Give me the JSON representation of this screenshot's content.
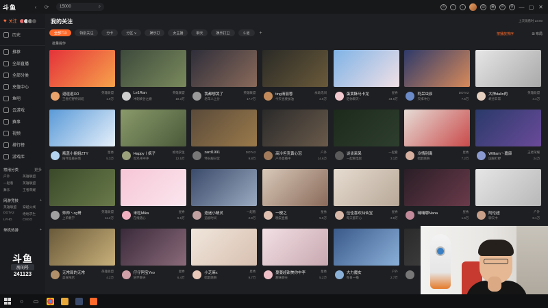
{
  "app": {
    "logo_text": "斗鱼",
    "search_value": "15000",
    "nav": {
      "back": "‹",
      "refresh": "⟳"
    },
    "window_controls": [
      "—",
      "▢",
      "✕"
    ]
  },
  "sidebar": {
    "follow_label": "关注",
    "history_label": "历史",
    "items": [
      {
        "label": "推荐"
      },
      {
        "label": "全部直播"
      },
      {
        "label": "全部分类"
      },
      {
        "label": "充值中心"
      },
      {
        "label": "鱼吧"
      },
      {
        "label": "云游戏"
      },
      {
        "label": "赛事"
      },
      {
        "label": "视频"
      },
      {
        "label": "排行榜"
      },
      {
        "label": "游戏库"
      }
    ],
    "section_common": "常用分类",
    "section_common_more": "更多",
    "common_cats": [
      "户外",
      "英雄联盟",
      "一起看",
      "英雄联盟",
      "舞乐",
      "王者荣耀"
    ],
    "section_hot": "网游竞技",
    "hot_cats": [
      "英雄联盟",
      "穿越火线",
      "DOTA2",
      "绝地求生",
      "LYHD",
      "CSGO"
    ],
    "section_mobile": "单机热游",
    "badge_logo": "斗鱼",
    "badge_sub": "房间号",
    "badge_num": "241123"
  },
  "main": {
    "title": "我的关注",
    "top_right": "上次观看时 23:00",
    "sort_label": "按播放排序",
    "layout_label": "⊞ 布局",
    "batch_label": "批量操作",
    "filters": [
      {
        "label": "全部713",
        "active": true
      },
      {
        "label": "特别关注",
        "active": false
      },
      {
        "label": "分卡",
        "active": false
      },
      {
        "label": "分区 ∨",
        "active": false
      },
      {
        "label": "娱乐打",
        "active": false
      },
      {
        "label": "女主播",
        "active": false
      },
      {
        "label": "聊天",
        "active": false
      },
      {
        "label": "娱乐打卫",
        "active": false
      },
      {
        "label": "斗道",
        "active": false
      }
    ],
    "cards": [
      {
        "name": "逗逗逗XO",
        "cat": "英雄联盟",
        "desc": "王者打野特训班",
        "heat": "1.9万",
        "bg": "linear-gradient(135deg,#e4323a,#f7a34b)",
        "av": "#e9a36b"
      },
      {
        "name": "Le1Ran",
        "cat": "英雄联盟",
        "desc": "冲刺峡谷之巅",
        "heat": "18.3万",
        "bg": "linear-gradient(135deg,#3d4a3c,#7a8a5c)",
        "av": "#cfcfcf"
      },
      {
        "name": "我都想哭了",
        "cat": "英雄联盟",
        "desc": "老年人上分",
        "heat": "17.7万",
        "bg": "linear-gradient(135deg,#2e2e3a,#8a6a5a)",
        "av": "#9a9a9a"
      },
      {
        "name": "ting清丽蓉",
        "cat": "永劫无间",
        "desc": "今天也要加油",
        "heat": "2.5万",
        "bg": "linear-gradient(135deg,#2a2a26,#6a5a3a)",
        "av": "#c28a5a"
      },
      {
        "name": "蛋黄酥马卡龙",
        "cat": "星秀",
        "desc": "陪你聊天~",
        "heat": "34.6万",
        "bg": "linear-gradient(135deg,#7fb3e6,#f1e0e6)",
        "av": "#f3c9d0"
      },
      {
        "name": "阿呆虫辰",
        "cat": "DOTA2",
        "desc": "天梯冲分",
        "heat": "7.5万",
        "bg": "linear-gradient(135deg,#2e3a6a,#d88a5a)",
        "av": "#6a8ac8"
      },
      {
        "name": "大神dalin的",
        "cat": "英雄联盟",
        "desc": "峡谷日常",
        "heat": "4.4万",
        "bg": "linear-gradient(135deg,#e6e6e6,#a9a9a9)",
        "av": "#e6d0c0"
      },
      {
        "name": "瓶盖小姐姐ZTY",
        "cat": "星秀",
        "desc": "陪伴是最长情",
        "heat": "5.3万",
        "bg": "linear-gradient(135deg,#5a9ad8,#e6f0fa)",
        "av": "#b2d2f0"
      },
      {
        "name": "Happy丨疯子",
        "cat": "绝地求生",
        "desc": "吃鸡冲冲冲",
        "heat": "12.5万",
        "bg": "linear-gradient(135deg,#8a9a6a,#4a5a3a)",
        "av": "#9aa07a"
      },
      {
        "name": "zard1991",
        "cat": "DOTA2",
        "desc": "怀旧服日常",
        "heat": "9.8万",
        "bg": "linear-gradient(135deg,#5a4a3a,#9a7a4a)",
        "av": "#777"
      },
      {
        "name": "高冷坦克黄心冠",
        "cat": "户外",
        "desc": "户外直播中",
        "heat": "14.6万",
        "bg": "linear-gradient(135deg,#2a2a2a,#6a5a4a)",
        "av": "#a07a5a"
      },
      {
        "name": "谈谈呆呆",
        "cat": "一起看",
        "desc": "一起看电影",
        "heat": "3.1万",
        "bg": "linear-gradient(135deg,#1c2a1c,#2e3e2e)",
        "av": "#5a5a5a"
      },
      {
        "name": "冷情别离",
        "cat": "星秀",
        "desc": "唱歌跳舞",
        "heat": "7.2万",
        "bg": "linear-gradient(135deg,#e6dcd6,#c94a4a)",
        "av": "#d7b0a0"
      },
      {
        "name": "William丶嘉康",
        "cat": "王者荣耀",
        "desc": "国服打野",
        "heat": "24万",
        "bg": "linear-gradient(135deg,#2a3a6a,#6a4a9a)",
        "av": "#8a9ad0"
      },
      {
        "name": "帅帅丶cg哥",
        "cat": "英雄联盟",
        "desc": "上单教学",
        "heat": "11.2万",
        "bg": "linear-gradient(135deg,#3a4a2a,#6a7a4a)",
        "av": "#a0a0a0"
      },
      {
        "name": "米粒Mika",
        "cat": "星秀",
        "desc": "在线随心",
        "heat": "6.6万",
        "bg": "linear-gradient(135deg,#f7c6d6,#fae6ee)",
        "av": "#f0b0c0"
      },
      {
        "name": "逐迷小精灵",
        "cat": "一起看",
        "desc": "追剧时间",
        "heat": "2.9万",
        "bg": "linear-gradient(135deg,#3a4a6a,#9aaac0)",
        "av": "#c0a0a0"
      },
      {
        "name": "一梗之",
        "cat": "星秀",
        "desc": "晚安直播",
        "heat": "5.5万",
        "bg": "linear-gradient(135deg,#d8c8b8,#8a6a5a)",
        "av": "#e0c0b0"
      },
      {
        "name": "佳佳喜欢仙仙宝",
        "cat": "星秀",
        "desc": "每天都开心",
        "heat": "3.8万",
        "bg": "linear-gradient(135deg,#e6dcd0,#b8a898)",
        "av": "#d8b8a8"
      },
      {
        "name": "哺哺哪Nana",
        "cat": "星秀",
        "desc": "",
        "heat": "1.6万",
        "bg": "linear-gradient(135deg,#2a1e26,#6a3a4a)",
        "av": "#c28a9a"
      },
      {
        "name": "阿伦超",
        "cat": "户外",
        "desc": "聊天中",
        "heat": "8.1万",
        "bg": "linear-gradient(135deg,#e6e6e6,#b8b8b8)",
        "av": "#c8a08a"
      },
      {
        "name": "无常局的无常",
        "cat": "英雄联盟",
        "desc": "美食探店",
        "heat": "4.2万",
        "bg": "linear-gradient(135deg,#6a5a3a,#c8b07a)",
        "av": "#b0906a"
      },
      {
        "name": "仔仔阿宝Yeo",
        "cat": "星秀",
        "desc": "陪伴聊天",
        "heat": "6.4万",
        "bg": "linear-gradient(135deg,#3a2a3a,#8a6a7a)",
        "av": "#d0a0a8"
      },
      {
        "name": "小芝麻x",
        "cat": "星秀",
        "desc": "唱歌跳舞",
        "heat": "9.7万",
        "bg": "linear-gradient(135deg,#f0e6dc,#d8c0b0)",
        "av": "#e8c8b8"
      },
      {
        "name": "蔓蔓超甜美你中李",
        "cat": "星秀",
        "desc": "甜妹聊天",
        "heat": "5.2万",
        "bg": "linear-gradient(135deg,#f2e0e4,#c8a8b0)",
        "av": "#f0c0c8"
      },
      {
        "name": "大力魔女",
        "cat": "户外",
        "desc": "每日一播",
        "heat": "2.7万",
        "bg": "linear-gradient(135deg,#3a5a8a,#8ab0d8)",
        "av": "#8ab0d8"
      },
      {
        "name": "",
        "cat": "户外",
        "desc": "",
        "heat": "",
        "bg": "linear-gradient(135deg,#2a2a2a,#4a4a4a)",
        "av": "#777"
      },
      {
        "name": "",
        "cat": "",
        "desc": "",
        "heat": "",
        "bg": "linear-gradient(135deg,#2a2a2a,#4a4a4a)",
        "av": "#777"
      }
    ]
  },
  "taskbar": {
    "icons": [
      "windows",
      "search-icon",
      "task-view-icon",
      "chrome-icon",
      "files-icon",
      "media-icon",
      "douyu-icon"
    ]
  },
  "colors": {
    "accent": "#ff6a2a",
    "bg": "#1e1f22",
    "sidebar": "#1a1b1e"
  }
}
